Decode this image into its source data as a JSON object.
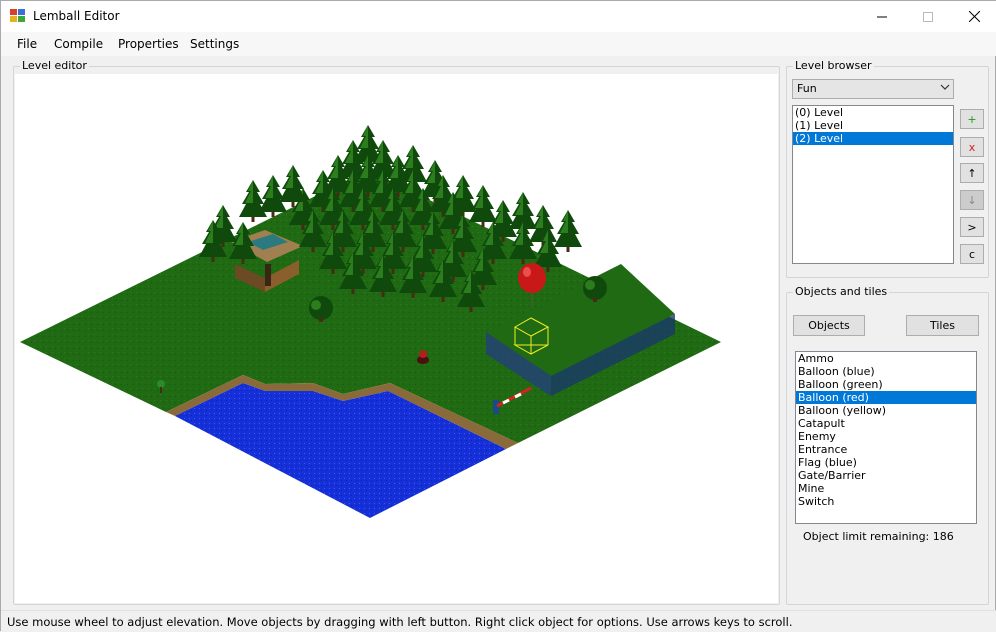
{
  "window": {
    "title": "Lemball Editor"
  },
  "menu": [
    "File",
    "Compile",
    "Properties",
    "Settings"
  ],
  "level_editor": {
    "label": "Level editor"
  },
  "level_browser": {
    "label": "Level browser",
    "set_selected": "Fun",
    "levels": [
      "(0) Level",
      "(1) Level",
      "(2) Level"
    ],
    "selected_index": 2,
    "buttons": [
      {
        "label": "+",
        "name": "add-level-button",
        "color": "#1a9a1a",
        "disabled": false
      },
      {
        "label": "x",
        "name": "delete-level-button",
        "color": "#d42020",
        "disabled": false
      },
      {
        "label": "↑",
        "name": "move-level-up-button",
        "color": "#000000",
        "disabled": false
      },
      {
        "label": "↓",
        "name": "move-level-down-button",
        "color": "#888888",
        "disabled": true
      },
      {
        "label": ">",
        "name": "next-level-button",
        "color": "#000000",
        "disabled": false
      },
      {
        "label": "c",
        "name": "copy-level-button",
        "color": "#000000",
        "disabled": false
      }
    ]
  },
  "objects_tiles": {
    "label": "Objects and tiles",
    "objects_button": "Objects",
    "tiles_button": "Tiles",
    "items": [
      "Ammo",
      "Balloon (blue)",
      "Balloon (green)",
      "Balloon (red)",
      "Balloon (yellow)",
      "Catapult",
      "Enemy",
      "Entrance",
      "Flag (blue)",
      "Gate/Barrier",
      "Mine",
      "Switch"
    ],
    "selected_index": 3,
    "limit_text": "Object limit remaining: 186"
  },
  "status": "Use mouse wheel to adjust elevation. Move objects by dragging with left button. Right click object for options. Use arrows keys to scroll.",
  "colors": {
    "selection": "#0078d7",
    "grass": "#1f6a12",
    "water": "#1530d8",
    "tree": "#0f4a0c"
  }
}
